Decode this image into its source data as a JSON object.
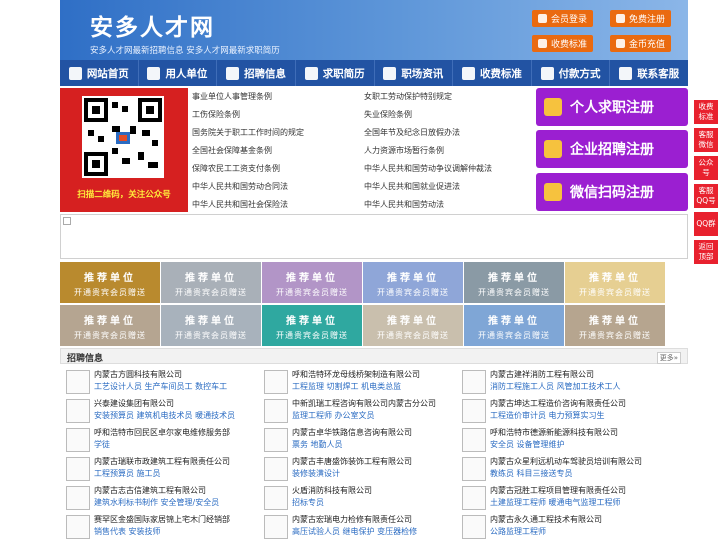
{
  "header": {
    "title": "安多人才网",
    "subtitle": "安多人才网最新招聘信息    安多人才网最新求职简历",
    "buttons": [
      "会员登录",
      "免费注册",
      "收费标准",
      "金币充值"
    ]
  },
  "nav": [
    "网站首页",
    "用人单位",
    "招聘信息",
    "求职简历",
    "职场资讯",
    "收费标准",
    "付款方式",
    "联系客服"
  ],
  "qr": {
    "caption": "扫描二维码，关注公众号"
  },
  "links_left": [
    "事业单位人事管理条例",
    "工伤保险条例",
    "国务院关于职工工作时间的规定",
    "全国社会保障基金条例",
    "保障农民工工资支付条例",
    "中华人民共和国劳动合同法",
    "中华人民共和国社会保险法"
  ],
  "links_right": [
    "女职工劳动保护特别规定",
    "失业保险条例",
    "全国年节及纪念日放假办法",
    "人力资源市场暂行条例",
    "中华人民共和国劳动争议调解仲裁法",
    "中华人民共和国就业促进法",
    "中华人民共和国劳动法"
  ],
  "register": [
    "个人求职注册",
    "企业招聘注册",
    "微信扫码注册"
  ],
  "recommend": {
    "title": "推荐单位",
    "sub": "开通贵宾会员赠送",
    "colors": [
      "#b98a2e",
      "#a9b0b8",
      "#b295c7",
      "#8fa6d8",
      "#8a9aa5",
      "#e6cf92",
      "#b5a591",
      "#a8b2bc",
      "#2fa8a0",
      "#c9bfad",
      "#7fa6d6",
      "#b6a58f"
    ]
  },
  "jobs": {
    "title": "招聘信息",
    "more": "更多»",
    "items": [
      {
        "company": "内蒙古方圆科技有限公司",
        "positions": "工艺设计人员 生产车间员工 数控车工"
      },
      {
        "company": "呼和浩特环龙母线桥架制造有限公司",
        "positions": "工程监理 切割焊工 机电类总监"
      },
      {
        "company": "内蒙古建祥消防工程有限公司",
        "positions": "消防工程施工人员 风管加工技术工人"
      },
      {
        "company": "兴泰建设集团有限公司",
        "positions": "安装预算员 建筑机电技术员 暖通技术员"
      },
      {
        "company": "中新凯瑞工程咨询有限公司内蒙古分公司",
        "positions": "监理工程师 办公室文员"
      },
      {
        "company": "内蒙古坤达工程造价咨询有限责任公司",
        "positions": "工程造价审计员 电力预算实习生"
      },
      {
        "company": "呼和浩特市回民区卓尔家电维修服务部",
        "positions": "学徒"
      },
      {
        "company": "内蒙古卓华铁路信息咨询有限公司",
        "positions": "票务 地勤人员"
      },
      {
        "company": "呼和浩特市德源新能源科技有限公司",
        "positions": "安全员 设备管理维护"
      },
      {
        "company": "内蒙古瑞联市政建筑工程有限责任公司",
        "positions": "工程预算员 施工员"
      },
      {
        "company": "内蒙古丰唐盛饰装饰工程有限公司",
        "positions": "装修装潢设计"
      },
      {
        "company": "内蒙古众星利远机动车驾驶员培训有限公司",
        "positions": "教练员 科目三接送专员"
      },
      {
        "company": "内蒙古志古信建筑工程有限公司",
        "positions": "建筑水利标书制作 安全管理/安全员"
      },
      {
        "company": "火盾消防科技有限公司",
        "positions": "招标专员"
      },
      {
        "company": "内蒙古冠胜工程项目管理有限责任公司",
        "positions": "土建监理工程师 暖通电气监理工程师"
      },
      {
        "company": "赛罕区金盛国际家居锦上宅木门经销部",
        "positions": "销售代表 安装技师"
      },
      {
        "company": "内蒙古宏瑞电力检修有限责任公司",
        "positions": "高压试验人员 继电保护 变压器检修"
      },
      {
        "company": "内蒙古永久通工程技术有限公司",
        "positions": "公路监理工程师"
      }
    ]
  },
  "side": [
    "收费标准",
    "客服微信",
    "公众号",
    "客服QQ号",
    "QQ群",
    "返回顶部"
  ]
}
